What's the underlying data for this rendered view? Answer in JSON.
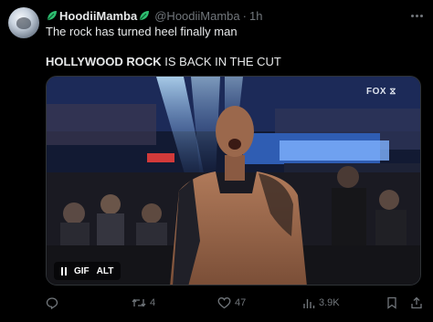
{
  "post": {
    "author_name": "HoodiiMamba",
    "handle": "@HoodiiMamba",
    "separator": "·",
    "time": "1h",
    "text_line1": "The rock has turned heel finally man",
    "text_line2_bold": "HOLLYWOOD ROCK",
    "text_line2_rest": " IS BACK IN THE CUT"
  },
  "media": {
    "broadcast_logo": "FOX ⧖",
    "gif_label": "GIF",
    "alt_label": "ALT"
  },
  "actions": {
    "reply_count": "",
    "retweet_count": "4",
    "like_count": "47",
    "views_count": "3.9K"
  },
  "colors": {
    "background": "#000000",
    "text_primary": "#e7e9ea",
    "text_secondary": "#71767b",
    "leaf_green": "#2fbf71"
  },
  "icons": [
    "avatar",
    "leaf-emoji-icon",
    "more-icon",
    "pause-icon",
    "reply-icon",
    "retweet-icon",
    "like-icon",
    "views-icon",
    "bookmark-icon",
    "share-icon"
  ]
}
